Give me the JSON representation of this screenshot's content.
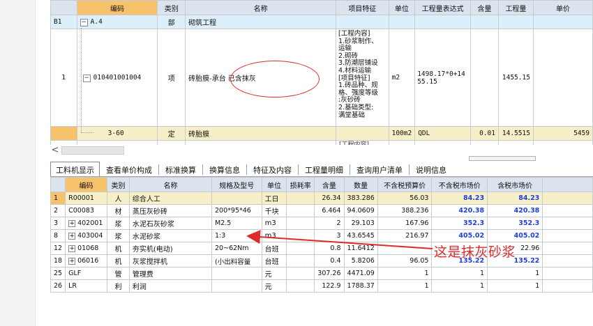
{
  "top_grid": {
    "headers": [
      "",
      "编码",
      "类别",
      "名称",
      "项目特征",
      "单位",
      "工程量表达式",
      "含量",
      "工程量",
      "单价"
    ],
    "row_b1": {
      "idx": "B1",
      "toggle": "−",
      "code": "A.4",
      "type": "部",
      "name": "砌筑工程"
    },
    "row_1": {
      "idx": "1",
      "toggle": "−",
      "code": "010401001004",
      "type": "项",
      "name": "砖胎膜-承台",
      "name_note": "已含抹灰",
      "feature_lines": [
        "[工程内容]",
        "1.砂浆制作、",
        "运输",
        "2.砌砖",
        "3.防潮层铺设",
        "4.材料运输",
        "[项目特征]",
        "1.砖品种、规",
        "格、强度等级",
        ":灰砂砖",
        "2.基础类型:",
        "满堂基础"
      ],
      "unit": "m2",
      "expr": "1498.17*0+14 55.15",
      "qty": "1455.15"
    },
    "row_sub": {
      "code": "3-60",
      "type": "定",
      "name": "砖胎膜",
      "unit": "100m2",
      "expr": "QDL",
      "content": "0.01",
      "qty": "14.5515",
      "price": "5459"
    },
    "row_next": {
      "feature": "[工程内容]"
    }
  },
  "scroll": {
    "left_arrow": "<"
  },
  "tabs": [
    "工料机显示",
    "查看单价构成",
    "标准换算",
    "换算信息",
    "特征及内容",
    "工程量明细",
    "查询用户清单",
    "说明信息"
  ],
  "bottom_grid": {
    "headers": [
      "",
      "编码",
      "类别",
      "名称",
      "规格及型号",
      "单位",
      "损耗率",
      "含量",
      "数量",
      "不含税预算价",
      "不含税市场价",
      "含税市场价",
      ""
    ],
    "rows": [
      {
        "idx": "1",
        "pm": "",
        "code": "R00001",
        "type": "人",
        "name": "综合人工",
        "spec": "",
        "unit": "工日",
        "loss": "",
        "content": "26.34",
        "qty": "383.286",
        "budget": "56.03",
        "market": "84.23",
        "market_tax": "84.23",
        "blue": true
      },
      {
        "idx": "2",
        "pm": "",
        "code": "C00083",
        "type": "材",
        "name": "蒸压灰砂砖",
        "spec": "200*95*46",
        "unit": "千块",
        "loss": "",
        "content": "6.464",
        "qty": "94.0609",
        "budget": "388.236",
        "market": "420.38",
        "market_tax": "420.38",
        "blue": true
      },
      {
        "idx": "3",
        "pm": "+",
        "code": "402001",
        "type": "浆",
        "name": "水泥石灰砂浆",
        "spec": "M2.5",
        "unit": "m3",
        "loss": "",
        "content": "2",
        "qty": "29.103",
        "budget": "167.96",
        "market": "352.3",
        "market_tax": "352.3",
        "blue": true
      },
      {
        "idx": "8",
        "pm": "+",
        "code": "403004",
        "type": "浆",
        "name": "水泥砂浆",
        "spec": "1:3",
        "unit": "m3",
        "loss": "",
        "content": "3",
        "qty": "43.6545",
        "budget": "216.97",
        "market": "405.02",
        "market_tax": "405.02",
        "blue": true
      },
      {
        "idx": "12",
        "pm": "+",
        "code": "01068",
        "type": "机",
        "name": "夯实机(电动)",
        "spec": "20~62Nm",
        "unit": "台班",
        "loss": "",
        "content": "0.8",
        "qty": "11.6412",
        "budget": "",
        "market": "",
        "market_tax": "22.96",
        "blue": false
      },
      {
        "idx": "18",
        "pm": "+",
        "code": "06016",
        "type": "机",
        "name": "灰浆搅拌机",
        "spec": "(小出料容量",
        "unit": "台班",
        "loss": "",
        "content": "0.4",
        "qty": "5.8206",
        "budget": "96.05",
        "market": "135.22",
        "market_tax": "135.22",
        "blue": true
      },
      {
        "idx": "25",
        "pm": "",
        "code": "GLF",
        "type": "管",
        "name": "管理费",
        "spec": "",
        "unit": "元",
        "loss": "",
        "content": "307.26",
        "qty": "4471.09",
        "budget": "1",
        "market": "1",
        "market_tax": "1",
        "blue": false
      },
      {
        "idx": "26",
        "pm": "",
        "code": "LR",
        "type": "利",
        "name": "利润",
        "spec": "",
        "unit": "元",
        "loss": "",
        "content": "122.9",
        "qty": "1788.37",
        "budget": "1",
        "market": "1",
        "market_tax": "1",
        "blue": false
      }
    ]
  },
  "annotation": {
    "text": "这是抹灰砂浆",
    "color": "#e02a2a"
  }
}
